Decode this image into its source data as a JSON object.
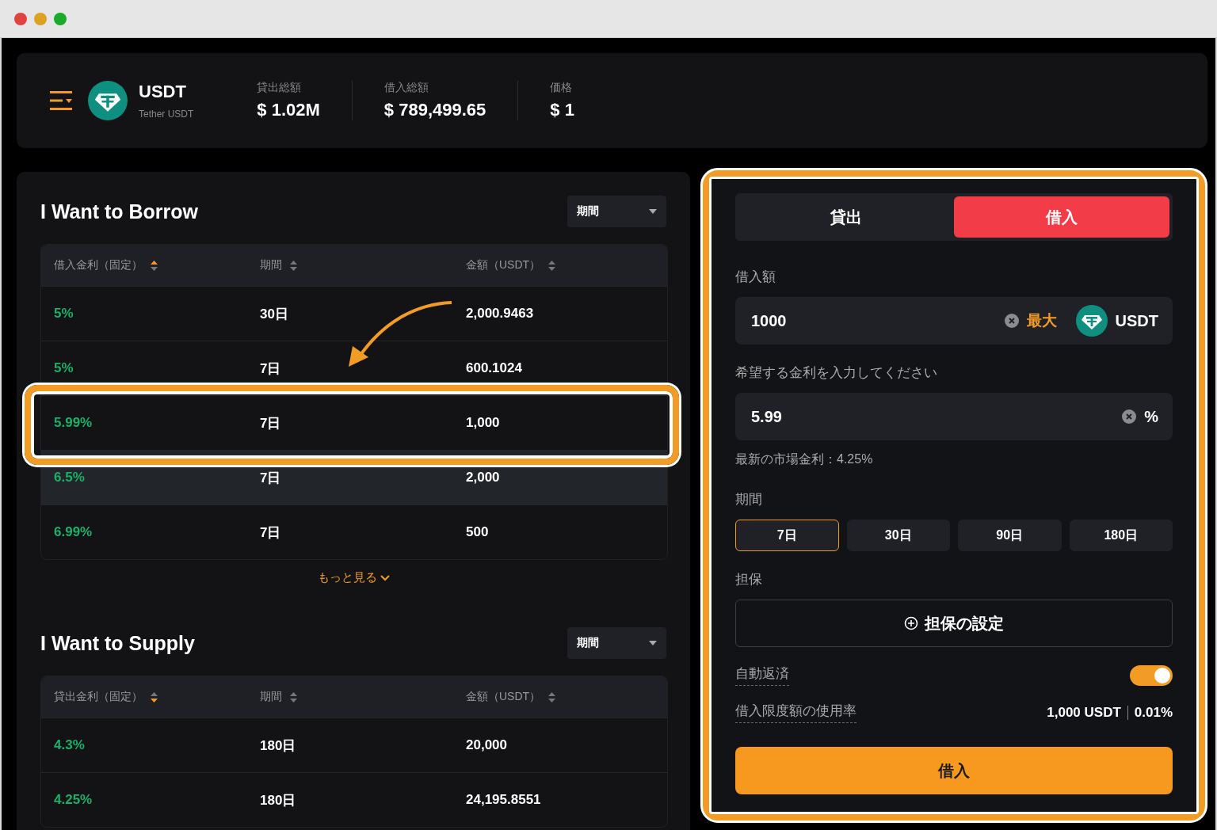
{
  "header": {
    "token": {
      "symbol": "USDT",
      "name": "Tether USDT"
    },
    "stats": [
      {
        "label": "貸出総額",
        "value": "$ 1.02M"
      },
      {
        "label": "借入総額",
        "value": "$ 789,499.65"
      },
      {
        "label": "価格",
        "value": "$ 1"
      }
    ]
  },
  "borrow_section": {
    "title": "I Want to Borrow",
    "filter": "期間",
    "columns": [
      {
        "label": "借入金利（固定）",
        "sort_up": true,
        "sort_down": false
      },
      {
        "label": "期間",
        "sort_up": false,
        "sort_down": false
      },
      {
        "label": "金額（USDT）",
        "sort_up": false,
        "sort_down": false
      }
    ],
    "rows": [
      {
        "rate": "5%",
        "term": "30日",
        "amount": "2,000.9463",
        "hovered": false,
        "callout": false
      },
      {
        "rate": "5%",
        "term": "7日",
        "amount": "600.1024",
        "hovered": false,
        "callout": false
      },
      {
        "rate": "5.99%",
        "term": "7日",
        "amount": "1,000",
        "hovered": false,
        "callout": true
      },
      {
        "rate": "6.5%",
        "term": "7日",
        "amount": "2,000",
        "hovered": true,
        "callout": false
      },
      {
        "rate": "6.99%",
        "term": "7日",
        "amount": "500",
        "hovered": false,
        "callout": false
      }
    ],
    "more": "もっと見る"
  },
  "supply_section": {
    "title": "I Want to Supply",
    "filter": "期間",
    "columns": [
      {
        "label": "貸出金利（固定）",
        "sort_up": false,
        "sort_down": true
      },
      {
        "label": "期間",
        "sort_up": false,
        "sort_down": false
      },
      {
        "label": "金額（USDT）",
        "sort_up": false,
        "sort_down": false
      }
    ],
    "rows": [
      {
        "rate": "4.3%",
        "term": "180日",
        "amount": "20,000",
        "hovered": false,
        "callout": false
      },
      {
        "rate": "4.25%",
        "term": "180日",
        "amount": "24,195.8551",
        "hovered": false,
        "callout": false
      }
    ]
  },
  "order_panel": {
    "callout": true,
    "tabs": [
      {
        "label": "貸出",
        "selected": false
      },
      {
        "label": "借入",
        "selected": true
      }
    ],
    "amount": {
      "label": "借入額",
      "value": "1000",
      "max": "最大",
      "unit": "USDT"
    },
    "rate": {
      "label": "希望する金利を入力してください",
      "value": "5.99",
      "unit": "%"
    },
    "market_rate": "最新の市場金利：4.25%",
    "term": {
      "label": "期間",
      "options": [
        {
          "label": "7日",
          "selected": true
        },
        {
          "label": "30日",
          "selected": false
        },
        {
          "label": "90日",
          "selected": false
        },
        {
          "label": "180日",
          "selected": false
        }
      ]
    },
    "collateral": {
      "label": "担保",
      "button": "担保の設定"
    },
    "auto_repay": {
      "label": "自動返済",
      "on": true
    },
    "usage": {
      "label": "借入限度額の使用率",
      "amount": "1,000 USDT",
      "percent": "0.01%"
    },
    "submit": "借入"
  }
}
